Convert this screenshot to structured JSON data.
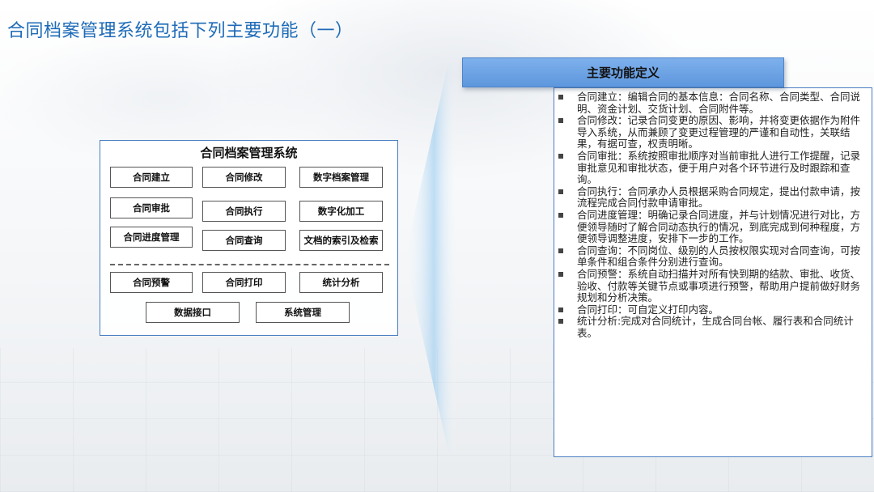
{
  "page": {
    "title": "合同档案管理系统包括下列主要功能（一）"
  },
  "system": {
    "title": "合同档案管理系统",
    "modules": [
      "合同建立",
      "合同修改",
      "数字档案管理",
      "合同审批",
      "合同执行",
      "数字化加工",
      "合同进度管理",
      "合同查询",
      "文档的索引及检索",
      "合同预警",
      "合同打印",
      "统计分析",
      "数据接口",
      "系统管理"
    ]
  },
  "definitions": {
    "header": "主要功能定义",
    "items": [
      "合同建立：编辑合同的基本信息：合同名称、合同类型、合同说明、资金计划、交货计划、合同附件等。",
      "合同修改：记录合同变更的原因、影响，并将变更依据作为附件导入系统，从而兼顾了变更过程管理的严谨和自动性，关联结果，有据可查，权责明晰。",
      "合同审批：系统按照审批顺序对当前审批人进行工作提醒，记录审批意见和审批状态，便于用户对各个环节进行及时跟踪和查询。",
      "合同执行：合同承办人员根据采购合同规定，提出付款申请，按流程完成合同付款申请审批。",
      "合同进度管理：明确记录合同进度，并与计划情况进行对比，方便领导随时了解合同动态执行的情况，到底完成到何种程度，方便领导调整进度，安排下一步的工作。",
      "合同查询：不同岗位、级别的人员按权限实现对合同查询，可按单条件和组合条件分别进行查询。",
      "合同预警：系统自动扫描并对所有快到期的结款、审批、收货、验收、付款等关键节点或事项进行预警，帮助用户提前做好财务规划和分析决策。",
      "合同打印：可自定义打印内容。",
      "统计分析:完成对合同统计，生成合同台帐、履行表和合同统计表。"
    ]
  },
  "colors": {
    "title": "#1e6bb8",
    "header_fill": "#6ea3e4",
    "panel_border": "#4a7fc1"
  }
}
